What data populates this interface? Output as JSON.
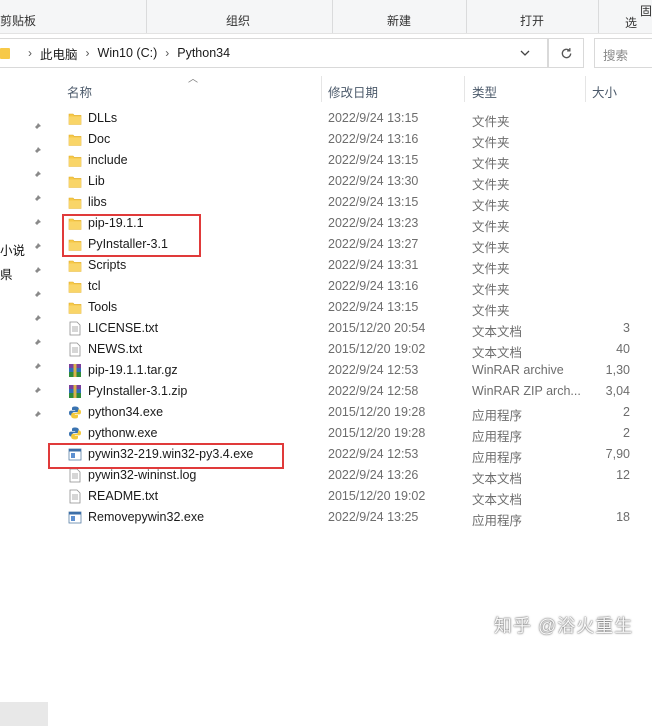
{
  "ribbon": {
    "clipboard_label": "剪贴板",
    "organize_label": "组织",
    "new_label": "新建",
    "open_label": "打开",
    "select_label": "选",
    "fixed_label": "固"
  },
  "address": {
    "crumbs": [
      "此电脑",
      "Win10 (C:)",
      "Python34"
    ],
    "search_placeholder": "搜索"
  },
  "nav": {
    "cut_labels": [
      "小说",
      "県"
    ]
  },
  "columns": {
    "name": "名称",
    "date": "修改日期",
    "type": "类型",
    "size": "大小"
  },
  "files": [
    {
      "name": "DLLs",
      "date": "2022/9/24 13:15",
      "type": "文件夹",
      "size": "",
      "icon": "folder-icon"
    },
    {
      "name": "Doc",
      "date": "2022/9/24 13:16",
      "type": "文件夹",
      "size": "",
      "icon": "folder-icon"
    },
    {
      "name": "include",
      "date": "2022/9/24 13:15",
      "type": "文件夹",
      "size": "",
      "icon": "folder-icon"
    },
    {
      "name": "Lib",
      "date": "2022/9/24 13:30",
      "type": "文件夹",
      "size": "",
      "icon": "folder-icon"
    },
    {
      "name": "libs",
      "date": "2022/9/24 13:15",
      "type": "文件夹",
      "size": "",
      "icon": "folder-icon"
    },
    {
      "name": "pip-19.1.1",
      "date": "2022/9/24 13:23",
      "type": "文件夹",
      "size": "",
      "icon": "folder-icon"
    },
    {
      "name": "PyInstaller-3.1",
      "date": "2022/9/24 13:27",
      "type": "文件夹",
      "size": "",
      "icon": "folder-icon"
    },
    {
      "name": "Scripts",
      "date": "2022/9/24 13:31",
      "type": "文件夹",
      "size": "",
      "icon": "folder-icon"
    },
    {
      "name": "tcl",
      "date": "2022/9/24 13:16",
      "type": "文件夹",
      "size": "",
      "icon": "folder-icon"
    },
    {
      "name": "Tools",
      "date": "2022/9/24 13:15",
      "type": "文件夹",
      "size": "",
      "icon": "folder-icon"
    },
    {
      "name": "LICENSE.txt",
      "date": "2015/12/20 20:54",
      "type": "文本文档",
      "size": "3",
      "icon": "text-file-icon"
    },
    {
      "name": "NEWS.txt",
      "date": "2015/12/20 19:02",
      "type": "文本文档",
      "size": "40",
      "icon": "text-file-icon"
    },
    {
      "name": "pip-19.1.1.tar.gz",
      "date": "2022/9/24 12:53",
      "type": "WinRAR archive",
      "size": "1,30",
      "icon": "winrar-archive-icon"
    },
    {
      "name": "PyInstaller-3.1.zip",
      "date": "2022/9/24 12:58",
      "type": "WinRAR ZIP arch...",
      "size": "3,04",
      "icon": "winrar-archive-icon"
    },
    {
      "name": "python34.exe",
      "date": "2015/12/20 19:28",
      "type": "应用程序",
      "size": "2",
      "icon": "python-icon"
    },
    {
      "name": "pythonw.exe",
      "date": "2015/12/20 19:28",
      "type": "应用程序",
      "size": "2",
      "icon": "python-icon"
    },
    {
      "name": "pywin32-219.win32-py3.4.exe",
      "date": "2022/9/24 12:53",
      "type": "应用程序",
      "size": "7,90",
      "icon": "installer-exe-icon"
    },
    {
      "name": "pywin32-wininst.log",
      "date": "2022/9/24 13:26",
      "type": "文本文档",
      "size": "12",
      "icon": "text-file-icon"
    },
    {
      "name": "README.txt",
      "date": "2015/12/20 19:02",
      "type": "文本文档",
      "size": "",
      "icon": "text-file-icon"
    },
    {
      "name": "Removepywin32.exe",
      "date": "2022/9/24 13:25",
      "type": "应用程序",
      "size": "18",
      "icon": "installer-exe-icon"
    }
  ],
  "watermark": "知乎 @浴火重生",
  "colors": {
    "folder": "#f7c948",
    "highlight": "#e03a3a",
    "header_text": "#4c5a6b"
  }
}
